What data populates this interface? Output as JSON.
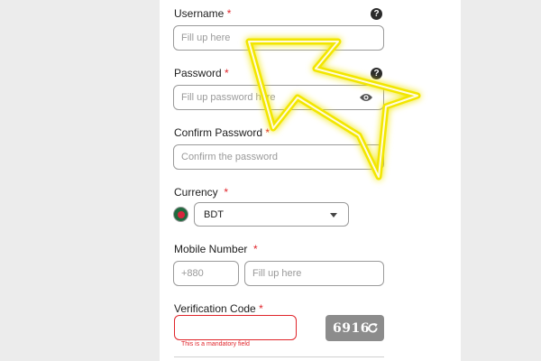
{
  "form": {
    "username": {
      "label": "Username",
      "required": "*",
      "placeholder": "Fill up here",
      "help": "?"
    },
    "password": {
      "label": "Password",
      "required": "*",
      "placeholder": "Fill up password here",
      "help": "?"
    },
    "confirm_password": {
      "label": "Confirm Password",
      "required": "*",
      "placeholder": "Confirm the password"
    },
    "currency": {
      "label": "Currency",
      "required": "*",
      "selected": "BDT"
    },
    "mobile": {
      "label": "Mobile Number",
      "required": "*",
      "country_code": "+880",
      "placeholder": "Fill up here"
    },
    "verification": {
      "label": "Verification Code",
      "required": "*",
      "error": "This is a mandatory field",
      "captcha": "6916"
    }
  },
  "colors": {
    "required": "#e0242a",
    "arrow": "#f2e600",
    "flag_green": "#1f6a3e",
    "flag_red": "#d7263d",
    "captcha_bg": "#8c8c8c"
  },
  "icons": [
    "help-icon",
    "eye-icon",
    "bangladesh-flag-icon",
    "chevron-down-icon",
    "refresh-icon",
    "arrow-annotation"
  ]
}
